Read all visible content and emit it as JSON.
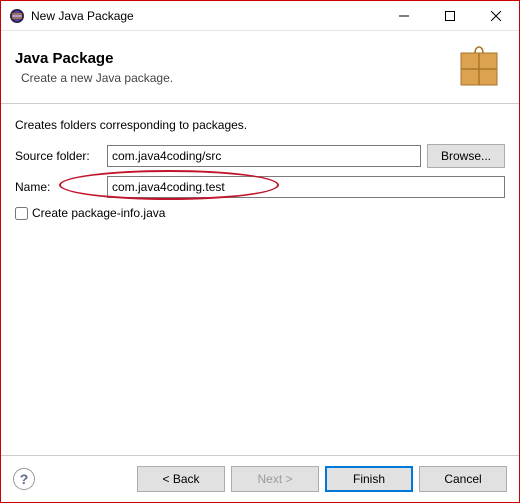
{
  "window": {
    "title": "New Java Package"
  },
  "header": {
    "title": "Java Package",
    "subtitle": "Create a new Java package."
  },
  "body": {
    "description": "Creates folders corresponding to packages.",
    "source_folder_label": "Source folder:",
    "source_folder_value": "com.java4coding/src",
    "browse_label": "Browse...",
    "name_label": "Name:",
    "name_value": "com.java4coding.test",
    "checkbox_label": "Create package-info.java"
  },
  "footer": {
    "back_label": "< Back",
    "next_label": "Next >",
    "finish_label": "Finish",
    "cancel_label": "Cancel"
  }
}
